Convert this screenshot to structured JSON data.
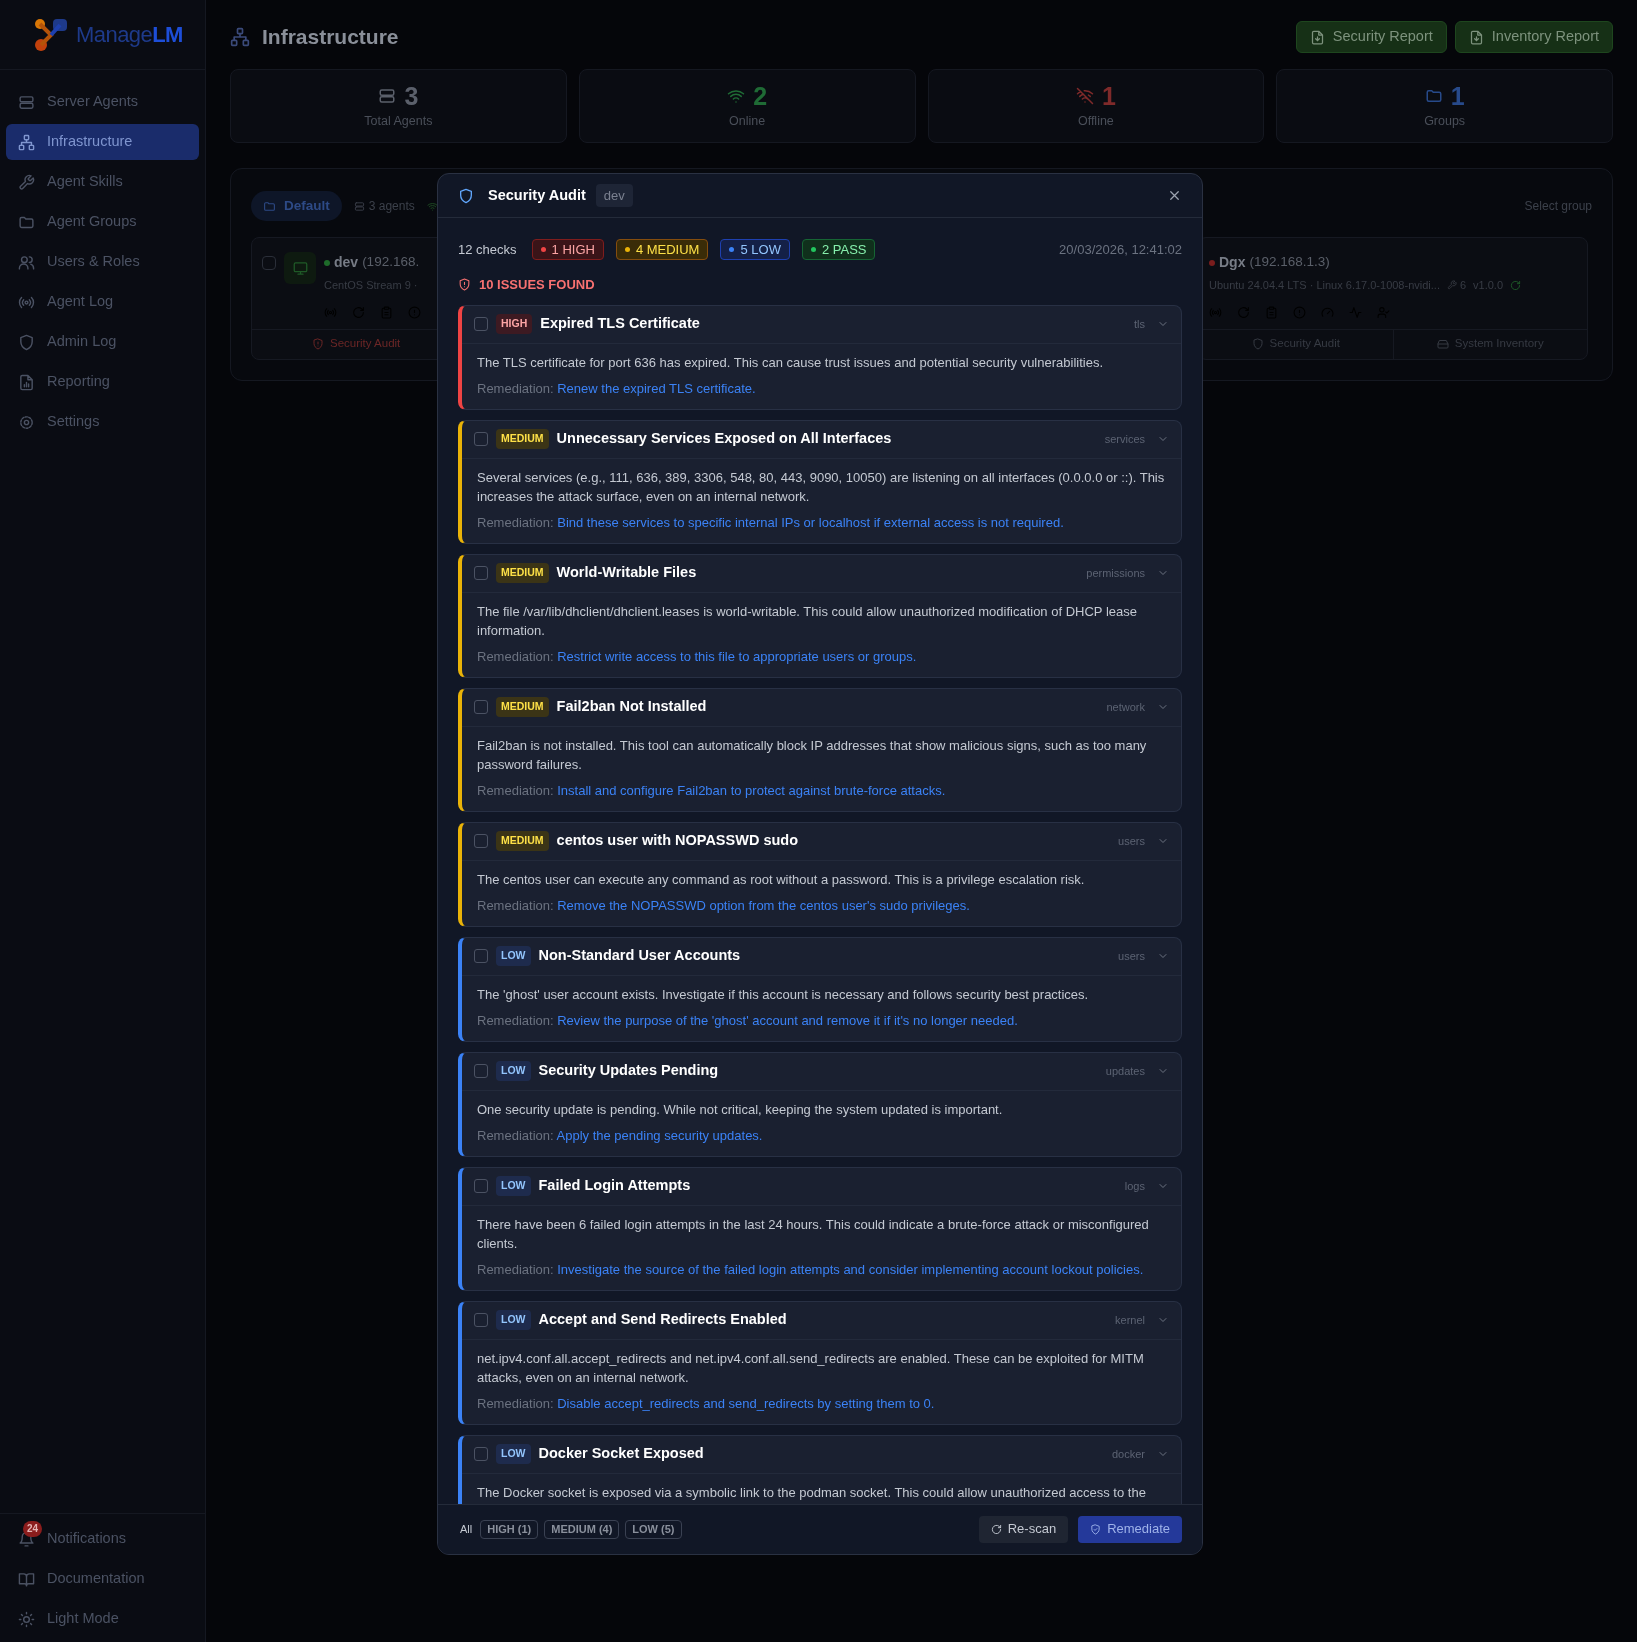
{
  "sidebar": {
    "logo": {
      "text": "Manage",
      "accent": "LM"
    },
    "nav": [
      {
        "label": "Server Agents",
        "selected": false
      },
      {
        "label": "Infrastructure",
        "selected": true
      },
      {
        "label": "Agent Skills",
        "selected": false
      },
      {
        "label": "Agent Groups",
        "selected": false
      },
      {
        "label": "Users & Roles",
        "selected": false
      },
      {
        "label": "Agent Log",
        "selected": false
      },
      {
        "label": "Admin Log",
        "selected": false
      },
      {
        "label": "Reporting",
        "selected": false
      },
      {
        "label": "Settings",
        "selected": false
      }
    ],
    "bottom": [
      {
        "label": "Notifications",
        "badge": "24"
      },
      {
        "label": "Documentation"
      },
      {
        "label": "Light Mode"
      }
    ]
  },
  "header": {
    "title": "Infrastructure",
    "buttons": [
      "Security Report",
      "Inventory Report"
    ]
  },
  "stats": [
    {
      "value": "3",
      "label": "Total Agents",
      "color": "#5b606b"
    },
    {
      "value": "2",
      "label": "Online",
      "color": "#1f6b35"
    },
    {
      "value": "1",
      "label": "Offline",
      "color": "#7f2a2a"
    },
    {
      "value": "1",
      "label": "Groups",
      "color": "#274a8a"
    }
  ],
  "group": {
    "tab": "Default",
    "count": "3 agents",
    "select": "Select group",
    "agents": [
      {
        "name": "dev",
        "ip": "(192.168.",
        "os": "CentOS Stream 9 ·",
        "online": true,
        "checked": false,
        "footer": [
          "Security Audit"
        ]
      },
      {
        "name": "Dgx",
        "ip": "(192.168.1.3)",
        "os": "Ubuntu 24.04.4 LTS · Linux 6.17.0-1008-nvidi...",
        "skills": "6",
        "version": "v1.0.0",
        "online": false,
        "footer": [
          "Security Audit",
          "System Inventory"
        ]
      }
    ]
  },
  "modal": {
    "title": "Security Audit",
    "tag": "dev",
    "checks": "12 checks",
    "summary": [
      {
        "kind": "high",
        "label": "1 HIGH"
      },
      {
        "kind": "medium",
        "label": "4 MEDIUM"
      },
      {
        "kind": "low",
        "label": "5 LOW"
      },
      {
        "kind": "pass",
        "label": "2 PASS"
      }
    ],
    "timestamp": "20/03/2026, 12:41:02",
    "issues": "10 ISSUES FOUND",
    "findings": [
      {
        "kind": "high",
        "severity": "HIGH",
        "title": "Expired TLS Certificate",
        "category": "tls",
        "checked": false,
        "description": "The TLS certificate for port 636 has expired. This can cause trust issues and potential security vulnerabilities.",
        "remediation_label": "Remediation:",
        "remediation": "Renew the expired TLS certificate."
      },
      {
        "kind": "medium",
        "severity": "MEDIUM",
        "title": "Unnecessary Services Exposed on All Interfaces",
        "category": "services",
        "checked": false,
        "description": "Several services (e.g., 111, 636, 389, 3306, 548, 80, 443, 9090, 10050) are listening on all interfaces (0.0.0.0 or ::). This increases the attack surface, even on an internal network.",
        "remediation_label": "Remediation:",
        "remediation": "Bind these services to specific internal IPs or localhost if external access is not required."
      },
      {
        "kind": "medium",
        "severity": "MEDIUM",
        "title": "World-Writable Files",
        "category": "permissions",
        "checked": false,
        "description": "The file /var/lib/dhclient/dhclient.leases is world-writable. This could allow unauthorized modification of DHCP lease information.",
        "remediation_label": "Remediation:",
        "remediation": "Restrict write access to this file to appropriate users or groups."
      },
      {
        "kind": "medium",
        "severity": "MEDIUM",
        "title": "Fail2ban Not Installed",
        "category": "network",
        "checked": false,
        "description": "Fail2ban is not installed. This tool can automatically block IP addresses that show malicious signs, such as too many password failures.",
        "remediation_label": "Remediation:",
        "remediation": "Install and configure Fail2ban to protect against brute-force attacks."
      },
      {
        "kind": "medium",
        "severity": "MEDIUM",
        "title": "centos user with NOPASSWD sudo",
        "category": "users",
        "checked": false,
        "description": "The centos user can execute any command as root without a password. This is a privilege escalation risk.",
        "remediation_label": "Remediation:",
        "remediation": "Remove the NOPASSWD option from the centos user's sudo privileges."
      },
      {
        "kind": "low",
        "severity": "LOW",
        "title": "Non-Standard User Accounts",
        "category": "users",
        "checked": false,
        "description": "The 'ghost' user account exists. Investigate if this account is necessary and follows security best practices.",
        "remediation_label": "Remediation:",
        "remediation": "Review the purpose of the 'ghost' account and remove it if it's no longer needed."
      },
      {
        "kind": "low",
        "severity": "LOW",
        "title": "Security Updates Pending",
        "category": "updates",
        "checked": false,
        "description": "One security update is pending. While not critical, keeping the system updated is important.",
        "remediation_label": "Remediation:",
        "remediation": "Apply the pending security updates."
      },
      {
        "kind": "low",
        "severity": "LOW",
        "title": "Failed Login Attempts",
        "category": "logs",
        "checked": false,
        "description": "There have been 6 failed login attempts in the last 24 hours. This could indicate a brute-force attack or misconfigured clients.",
        "remediation_label": "Remediation:",
        "remediation": "Investigate the source of the failed login attempts and consider implementing account lockout policies."
      },
      {
        "kind": "low",
        "severity": "LOW",
        "title": "Accept and Send Redirects Enabled",
        "category": "kernel",
        "checked": false,
        "description": "net.ipv4.conf.all.accept_redirects and net.ipv4.conf.all.send_redirects are enabled. These can be exploited for MITM attacks, even on an internal network.",
        "remediation_label": "Remediation:",
        "remediation": "Disable accept_redirects and send_redirects by setting them to 0."
      },
      {
        "kind": "low",
        "severity": "LOW",
        "title": "Docker Socket Exposed",
        "category": "docker",
        "checked": false,
        "description": "The Docker socket is exposed via a symbolic link to the podman socket. This could allow unauthorized access to the"
      }
    ],
    "filters": [
      {
        "label": "All",
        "selected": true
      },
      {
        "label": "HIGH (1)",
        "selected": false
      },
      {
        "label": "MEDIUM (4)",
        "selected": false
      },
      {
        "label": "LOW (5)",
        "selected": false
      }
    ],
    "actions": [
      {
        "kind": "secondary",
        "label": "Re-scan"
      },
      {
        "kind": "primary",
        "label": "Remediate"
      }
    ]
  }
}
